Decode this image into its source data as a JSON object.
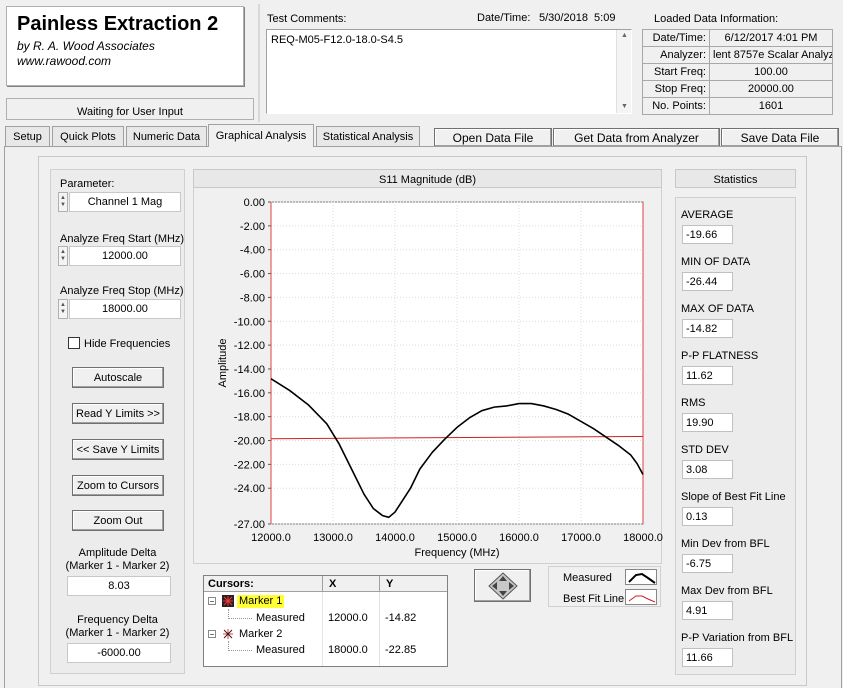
{
  "header": {
    "app_title": "Painless Extraction 2",
    "company": "by R. A. Wood Associates",
    "website": "www.rawood.com",
    "status": "Waiting for User Input"
  },
  "comments": {
    "label": "Test Comments:",
    "text": "REQ-M05-F12.0-18.0-S4.5"
  },
  "datetime": {
    "label": "Date/Time:",
    "value": "5/30/2018  5:09"
  },
  "loaded": {
    "title": "Loaded Data Information:",
    "rows": [
      {
        "label": "Date/Time:",
        "value": "6/12/2017 4:01 PM"
      },
      {
        "label": "Analyzer:",
        "value": "lent 8757e Scalar Analyz"
      },
      {
        "label": "Start Freq:",
        "value": "100.00"
      },
      {
        "label": "Stop Freq:",
        "value": "20000.00"
      },
      {
        "label": "No. Points:",
        "value": "1601"
      }
    ]
  },
  "tabs": [
    "Setup",
    "Quick Plots",
    "Numeric Data",
    "Graphical Analysis",
    "Statistical Analysis"
  ],
  "actions": {
    "open": "Open Data File",
    "get": "Get Data from Analyzer",
    "save": "Save Data File"
  },
  "left": {
    "parameter_label": "Parameter:",
    "parameter_value": "Channel 1 Mag",
    "start_label": "Analyze Freq Start (MHz)",
    "start_value": "12000.00",
    "stop_label": "Analyze Freq Stop (MHz)",
    "stop_value": "18000.00",
    "hide_freq": "Hide Frequencies",
    "autoscale": "Autoscale",
    "read_y": "Read Y Limits >>",
    "save_y": "<< Save Y Limits",
    "zoom_cursors": "Zoom to Cursors",
    "zoom_out": "Zoom Out",
    "amp_delta_label1": "Amplitude Delta",
    "amp_delta_label2": "(Marker 1 - Marker 2)",
    "amp_delta_value": "8.03",
    "freq_delta_label1": "Frequency Delta",
    "freq_delta_label2": "(Marker 1 - Marker 2)",
    "freq_delta_value": "-6000.00"
  },
  "cursors": {
    "header": {
      "name": "Cursors:",
      "x": "X",
      "y": "Y"
    },
    "markers": [
      {
        "name": "Marker 1",
        "sub": "Measured",
        "x": "12000.0",
        "y": "-14.82"
      },
      {
        "name": "Marker 2",
        "sub": "Measured",
        "x": "18000.0",
        "y": "-22.85"
      }
    ]
  },
  "legend": {
    "measured": "Measured",
    "bestfit": "Best Fit Line"
  },
  "statistics": {
    "title": "Statistics",
    "items": [
      {
        "label": "AVERAGE",
        "value": "-19.66"
      },
      {
        "label": "MIN OF DATA",
        "value": "-26.44"
      },
      {
        "label": "MAX OF DATA",
        "value": "-14.82"
      },
      {
        "label": "P-P FLATNESS",
        "value": "11.62"
      },
      {
        "label": "RMS",
        "value": "19.90"
      },
      {
        "label": "STD DEV",
        "value": "3.08"
      },
      {
        "label": "Slope of Best Fit Line",
        "value": "0.13"
      },
      {
        "label": "Min Dev from BFL",
        "value": "-6.75"
      },
      {
        "label": "Max Dev from BFL",
        "value": "4.91"
      },
      {
        "label": "P-P Variation from BFL",
        "value": "11.66"
      }
    ]
  },
  "colors": {
    "measured": "#000000",
    "bestfit": "#d02020",
    "marker_highlight": "#ffff33"
  },
  "chart_data": {
    "type": "line",
    "title": "S11 Magnitude (dB)",
    "xlabel": "Frequency (MHz)",
    "ylabel": "Amplitude",
    "xlim": [
      12000,
      18000
    ],
    "ylim": [
      -27,
      0
    ],
    "x_ticks": [
      "12000.0",
      "13000.0",
      "14000.0",
      "15000.0",
      "16000.0",
      "17000.0",
      "18000.0"
    ],
    "x_tick_values": [
      12000,
      13000,
      14000,
      15000,
      16000,
      17000,
      18000
    ],
    "y_ticks": [
      "0.00",
      "-2.00",
      "-4.00",
      "-6.00",
      "-8.00",
      "-10.00",
      "-12.00",
      "-14.00",
      "-16.00",
      "-18.00",
      "-20.00",
      "-22.00",
      "-24.00",
      "-27.00"
    ],
    "y_tick_values": [
      0,
      -2,
      -4,
      -6,
      -8,
      -10,
      -12,
      -14,
      -16,
      -18,
      -20,
      -22,
      -24,
      -27
    ],
    "series": [
      {
        "name": "Measured",
        "x": [
          12000,
          12300,
          12600,
          12900,
          13100,
          13300,
          13500,
          13650,
          13800,
          13900,
          14000,
          14100,
          14250,
          14400,
          14600,
          14800,
          15000,
          15200,
          15400,
          15600,
          15800,
          16000,
          16200,
          16400,
          16600,
          16800,
          17000,
          17200,
          17400,
          17600,
          17800,
          17900,
          18000
        ],
        "y": [
          -14.82,
          -15.8,
          -17.0,
          -18.6,
          -20.3,
          -22.4,
          -24.5,
          -25.7,
          -26.3,
          -26.44,
          -26.0,
          -25.2,
          -24.0,
          -22.4,
          -21.0,
          -19.9,
          -18.9,
          -18.1,
          -17.5,
          -17.2,
          -17.1,
          -16.9,
          -16.9,
          -17.1,
          -17.4,
          -17.8,
          -18.4,
          -19.0,
          -19.7,
          -20.4,
          -21.2,
          -21.9,
          -22.85
        ]
      },
      {
        "name": "Best Fit Line",
        "x": [
          12000,
          18000
        ],
        "y": [
          -19.85,
          -19.66
        ]
      }
    ],
    "cursors_x": [
      12000,
      18000
    ]
  }
}
